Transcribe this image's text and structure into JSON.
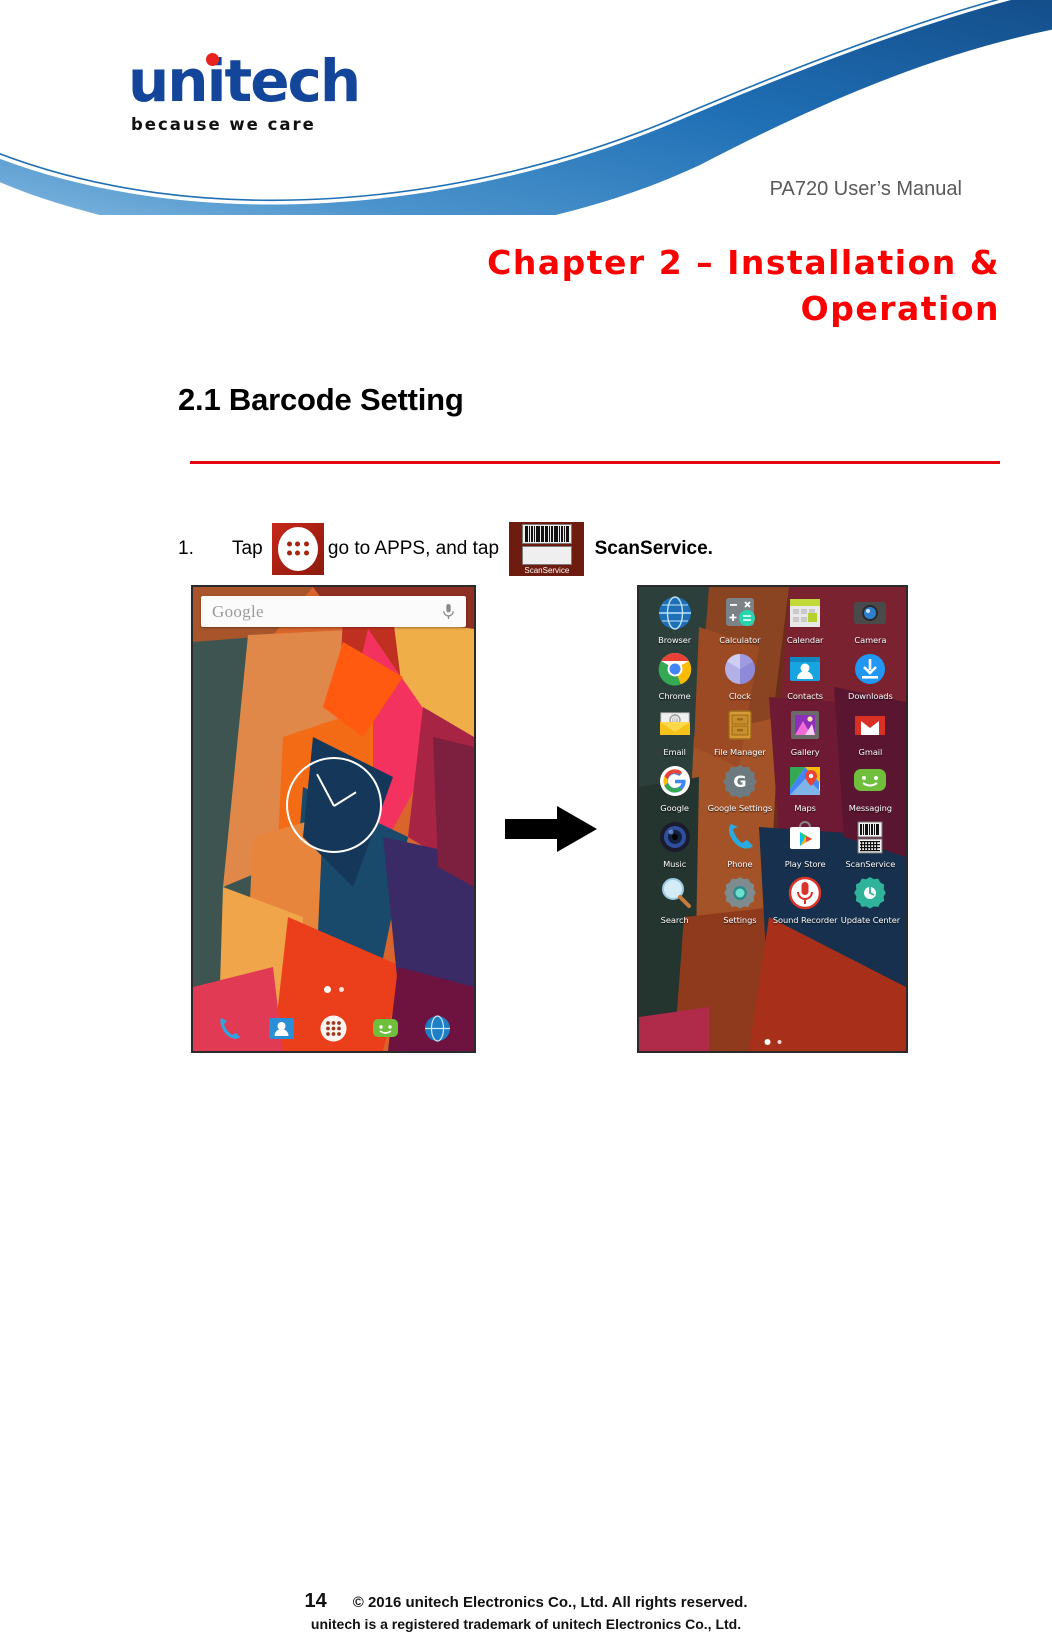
{
  "header": {
    "logo_word": "unitech",
    "logo_tagline": "because we care",
    "manual_title": "PA720 User’s Manual"
  },
  "chapter": {
    "title_line1": "Chapter 2 – Installation &",
    "title_line2": "Operation"
  },
  "section": {
    "heading": "2.1 Barcode Setting"
  },
  "step": {
    "number": "1.",
    "text_before_icon": "Tap",
    "text_middle": "go to APPS, and tap",
    "text_bold": "ScanService.",
    "apps_icon_name": "apps-drawer-icon",
    "scan_icon_label": "ScanService"
  },
  "home_screen": {
    "search_placeholder": "Google",
    "mic_icon": "microphone-icon",
    "page_dots": 2,
    "dock": [
      {
        "name": "phone",
        "color": "#2fa4e0"
      },
      {
        "name": "contacts",
        "color": "#2a8fd6"
      },
      {
        "name": "apps",
        "color": "#ffffff"
      },
      {
        "name": "messaging",
        "color": "#6fbf3c"
      },
      {
        "name": "browser",
        "color": "#1f7fc4"
      }
    ]
  },
  "apps_screen": {
    "page_dots": 2,
    "apps": [
      {
        "label": "Browser",
        "icon": "browser-icon",
        "color": "#1d6fb8"
      },
      {
        "label": "Calculator",
        "icon": "calculator-icon",
        "color": "#7c8387"
      },
      {
        "label": "Calendar",
        "icon": "calendar-icon",
        "color": "#c2d93a"
      },
      {
        "label": "Camera",
        "icon": "camera-icon",
        "color": "#4a4a4a"
      },
      {
        "label": "Chrome",
        "icon": "chrome-icon",
        "color": "#d93025"
      },
      {
        "label": "Clock",
        "icon": "clock-icon",
        "color": "#9b9be0"
      },
      {
        "label": "Contacts",
        "icon": "contacts-icon",
        "color": "#18a4e0"
      },
      {
        "label": "Downloads",
        "icon": "downloads-icon",
        "color": "#2196f3"
      },
      {
        "label": "Email",
        "icon": "email-icon",
        "color": "#f7b500"
      },
      {
        "label": "File Manager",
        "icon": "file-manager-icon",
        "color": "#d79a36"
      },
      {
        "label": "Gallery",
        "icon": "gallery-icon",
        "color": "#c04ad0"
      },
      {
        "label": "Gmail",
        "icon": "gmail-icon",
        "color": "#d93025"
      },
      {
        "label": "Google",
        "icon": "google-icon",
        "color": "#4285f4"
      },
      {
        "label": "Google Settings",
        "icon": "google-settings-icon",
        "color": "#6d7b80"
      },
      {
        "label": "Maps",
        "icon": "maps-icon",
        "color": "#34a853"
      },
      {
        "label": "Messaging",
        "icon": "messaging-icon",
        "color": "#6fbf3c"
      },
      {
        "label": "Music",
        "icon": "music-icon",
        "color": "#2a4a8a"
      },
      {
        "label": "Phone",
        "icon": "phone-icon",
        "color": "#29abe2"
      },
      {
        "label": "Play Store",
        "icon": "play-store-icon",
        "color": "#ffffff"
      },
      {
        "label": "ScanService",
        "icon": "scanservice-icon",
        "color": "#e9e9e9"
      },
      {
        "label": "Search",
        "icon": "search-icon",
        "color": "#cfe8f5"
      },
      {
        "label": "Settings",
        "icon": "settings-icon",
        "color": "#7f8c8f"
      },
      {
        "label": "Sound Recorder",
        "icon": "sound-recorder-icon",
        "color": "#d8342a"
      },
      {
        "label": "Update Center",
        "icon": "update-center-icon",
        "color": "#2fb39a"
      }
    ]
  },
  "flow": {
    "arrow_icon": "right-arrow-icon"
  },
  "footer": {
    "page_number": "14",
    "copyright": "© 2016 unitech Electronics Co., Ltd. All rights reserved.",
    "trademark": "unitech is a registered trademark of unitech Electronics Co., Ltd."
  },
  "colors": {
    "chapter_red": "#fa0000",
    "rule_red": "#e40613",
    "logo_blue": "#13459b",
    "logo_dot_red": "#e8231f",
    "swoosh_blue": "#1f6fb5"
  }
}
